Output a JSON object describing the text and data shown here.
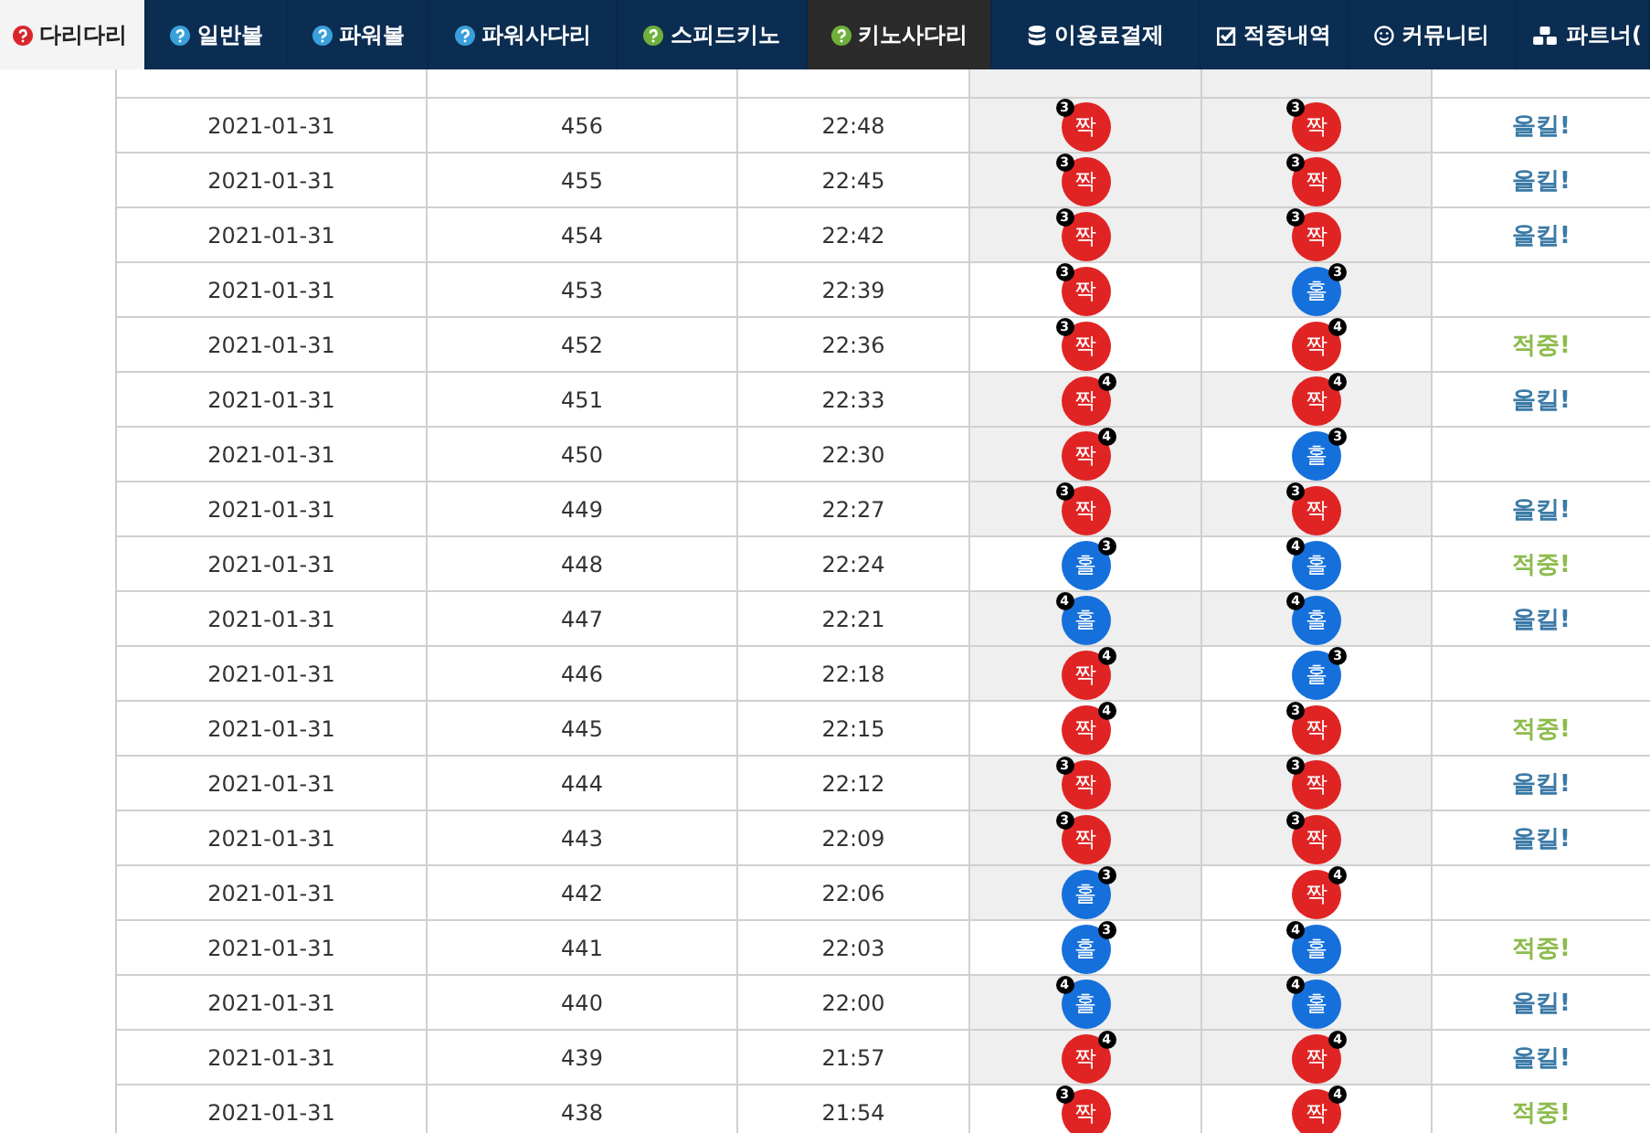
{
  "nav": {
    "tabs": [
      {
        "label": "다리다리",
        "kind": "question",
        "color": "#d9262c",
        "selected": true,
        "highlighted": false
      },
      {
        "label": "일반볼",
        "kind": "question",
        "color": "#3aa0dc",
        "selected": false,
        "highlighted": false
      },
      {
        "label": "파워볼",
        "kind": "question",
        "color": "#3aa0dc",
        "selected": false,
        "highlighted": false
      },
      {
        "label": "파워사다리",
        "kind": "question",
        "color": "#3aa0dc",
        "selected": false,
        "highlighted": false
      },
      {
        "label": "스피드키노",
        "kind": "question",
        "color": "#6fb03c",
        "selected": false,
        "highlighted": false
      },
      {
        "label": "키노사다리",
        "kind": "question",
        "color": "#6fb03c",
        "selected": false,
        "highlighted": true
      },
      {
        "label": "이용료결제",
        "kind": "database",
        "selected": false,
        "highlighted": false
      },
      {
        "label": "적중내역",
        "kind": "check",
        "selected": false,
        "highlighted": false
      },
      {
        "label": "커뮤니티",
        "kind": "smile",
        "selected": false,
        "highlighted": false
      },
      {
        "label": "파트너(",
        "kind": "cubes",
        "selected": false,
        "highlighted": false
      }
    ]
  },
  "table": {
    "rows": [
      {
        "date": "2021-01-31",
        "round": "456",
        "time": "22:48",
        "balls": [
          {
            "kind": "even",
            "label": "짝",
            "badge": "3",
            "badge_left": true,
            "shaded": true
          },
          {
            "kind": "even",
            "label": "짝",
            "badge": "3",
            "badge_left": true,
            "shaded": true
          }
        ],
        "result": {
          "kind": "allkill",
          "text": "올킬!"
        }
      },
      {
        "date": "2021-01-31",
        "round": "455",
        "time": "22:45",
        "balls": [
          {
            "kind": "even",
            "label": "짝",
            "badge": "3",
            "badge_left": true,
            "shaded": true
          },
          {
            "kind": "even",
            "label": "짝",
            "badge": "3",
            "badge_left": true,
            "shaded": true
          }
        ],
        "result": {
          "kind": "allkill",
          "text": "올킬!"
        }
      },
      {
        "date": "2021-01-31",
        "round": "454",
        "time": "22:42",
        "balls": [
          {
            "kind": "even",
            "label": "짝",
            "badge": "3",
            "badge_left": true,
            "shaded": true
          },
          {
            "kind": "even",
            "label": "짝",
            "badge": "3",
            "badge_left": true,
            "shaded": true
          }
        ],
        "result": {
          "kind": "allkill",
          "text": "올킬!"
        }
      },
      {
        "date": "2021-01-31",
        "round": "453",
        "time": "22:39",
        "balls": [
          {
            "kind": "even",
            "label": "짝",
            "badge": "3",
            "badge_left": true,
            "shaded": false
          },
          {
            "kind": "odd",
            "label": "홀",
            "badge": "3",
            "badge_left": false,
            "shaded": true
          }
        ]
      },
      {
        "date": "2021-01-31",
        "round": "452",
        "time": "22:36",
        "balls": [
          {
            "kind": "even",
            "label": "짝",
            "badge": "3",
            "badge_left": true,
            "shaded": false
          },
          {
            "kind": "even",
            "label": "짝",
            "badge": "4",
            "badge_left": false,
            "shaded": false
          }
        ],
        "result": {
          "kind": "hit",
          "text": "적중!"
        }
      },
      {
        "date": "2021-01-31",
        "round": "451",
        "time": "22:33",
        "balls": [
          {
            "kind": "even",
            "label": "짝",
            "badge": "4",
            "badge_left": false,
            "shaded": true
          },
          {
            "kind": "even",
            "label": "짝",
            "badge": "4",
            "badge_left": false,
            "shaded": true
          }
        ],
        "result": {
          "kind": "allkill",
          "text": "올킬!"
        }
      },
      {
        "date": "2021-01-31",
        "round": "450",
        "time": "22:30",
        "balls": [
          {
            "kind": "even",
            "label": "짝",
            "badge": "4",
            "badge_left": false,
            "shaded": true
          },
          {
            "kind": "odd",
            "label": "홀",
            "badge": "3",
            "badge_left": false,
            "shaded": false
          }
        ]
      },
      {
        "date": "2021-01-31",
        "round": "449",
        "time": "22:27",
        "balls": [
          {
            "kind": "even",
            "label": "짝",
            "badge": "3",
            "badge_left": true,
            "shaded": true
          },
          {
            "kind": "even",
            "label": "짝",
            "badge": "3",
            "badge_left": true,
            "shaded": true
          }
        ],
        "result": {
          "kind": "allkill",
          "text": "올킬!"
        }
      },
      {
        "date": "2021-01-31",
        "round": "448",
        "time": "22:24",
        "balls": [
          {
            "kind": "odd",
            "label": "홀",
            "badge": "3",
            "badge_left": false,
            "shaded": false
          },
          {
            "kind": "odd",
            "label": "홀",
            "badge": "4",
            "badge_left": true,
            "shaded": false
          }
        ],
        "result": {
          "kind": "hit",
          "text": "적중!"
        }
      },
      {
        "date": "2021-01-31",
        "round": "447",
        "time": "22:21",
        "balls": [
          {
            "kind": "odd",
            "label": "홀",
            "badge": "4",
            "badge_left": true,
            "shaded": true
          },
          {
            "kind": "odd",
            "label": "홀",
            "badge": "4",
            "badge_left": true,
            "shaded": true
          }
        ],
        "result": {
          "kind": "allkill",
          "text": "올킬!"
        }
      },
      {
        "date": "2021-01-31",
        "round": "446",
        "time": "22:18",
        "balls": [
          {
            "kind": "even",
            "label": "짝",
            "badge": "4",
            "badge_left": false,
            "shaded": true
          },
          {
            "kind": "odd",
            "label": "홀",
            "badge": "3",
            "badge_left": false,
            "shaded": false
          }
        ]
      },
      {
        "date": "2021-01-31",
        "round": "445",
        "time": "22:15",
        "balls": [
          {
            "kind": "even",
            "label": "짝",
            "badge": "4",
            "badge_left": false,
            "shaded": false
          },
          {
            "kind": "even",
            "label": "짝",
            "badge": "3",
            "badge_left": true,
            "shaded": false
          }
        ],
        "result": {
          "kind": "hit",
          "text": "적중!"
        }
      },
      {
        "date": "2021-01-31",
        "round": "444",
        "time": "22:12",
        "balls": [
          {
            "kind": "even",
            "label": "짝",
            "badge": "3",
            "badge_left": true,
            "shaded": true
          },
          {
            "kind": "even",
            "label": "짝",
            "badge": "3",
            "badge_left": true,
            "shaded": true
          }
        ],
        "result": {
          "kind": "allkill",
          "text": "올킬!"
        }
      },
      {
        "date": "2021-01-31",
        "round": "443",
        "time": "22:09",
        "balls": [
          {
            "kind": "even",
            "label": "짝",
            "badge": "3",
            "badge_left": true,
            "shaded": true
          },
          {
            "kind": "even",
            "label": "짝",
            "badge": "3",
            "badge_left": true,
            "shaded": true
          }
        ],
        "result": {
          "kind": "allkill",
          "text": "올킬!"
        }
      },
      {
        "date": "2021-01-31",
        "round": "442",
        "time": "22:06",
        "balls": [
          {
            "kind": "odd",
            "label": "홀",
            "badge": "3",
            "badge_left": false,
            "shaded": true
          },
          {
            "kind": "even",
            "label": "짝",
            "badge": "4",
            "badge_left": false,
            "shaded": false
          }
        ]
      },
      {
        "date": "2021-01-31",
        "round": "441",
        "time": "22:03",
        "balls": [
          {
            "kind": "odd",
            "label": "홀",
            "badge": "3",
            "badge_left": false,
            "shaded": false
          },
          {
            "kind": "odd",
            "label": "홀",
            "badge": "4",
            "badge_left": true,
            "shaded": false
          }
        ],
        "result": {
          "kind": "hit",
          "text": "적중!"
        }
      },
      {
        "date": "2021-01-31",
        "round": "440",
        "time": "22:00",
        "balls": [
          {
            "kind": "odd",
            "label": "홀",
            "badge": "4",
            "badge_left": true,
            "shaded": true
          },
          {
            "kind": "odd",
            "label": "홀",
            "badge": "4",
            "badge_left": true,
            "shaded": true
          }
        ],
        "result": {
          "kind": "allkill",
          "text": "올킬!"
        }
      },
      {
        "date": "2021-01-31",
        "round": "439",
        "time": "21:57",
        "balls": [
          {
            "kind": "even",
            "label": "짝",
            "badge": "4",
            "badge_left": false,
            "shaded": true
          },
          {
            "kind": "even",
            "label": "짝",
            "badge": "4",
            "badge_left": false,
            "shaded": true
          }
        ],
        "result": {
          "kind": "allkill",
          "text": "올킬!"
        }
      },
      {
        "date": "2021-01-31",
        "round": "438",
        "time": "21:54",
        "balls": [
          {
            "kind": "even",
            "label": "짝",
            "badge": "3",
            "badge_left": true,
            "shaded": false
          },
          {
            "kind": "even",
            "label": "짝",
            "badge": "4",
            "badge_left": false,
            "shaded": false
          }
        ],
        "result": {
          "kind": "hit",
          "text": "적중!"
        }
      }
    ]
  }
}
